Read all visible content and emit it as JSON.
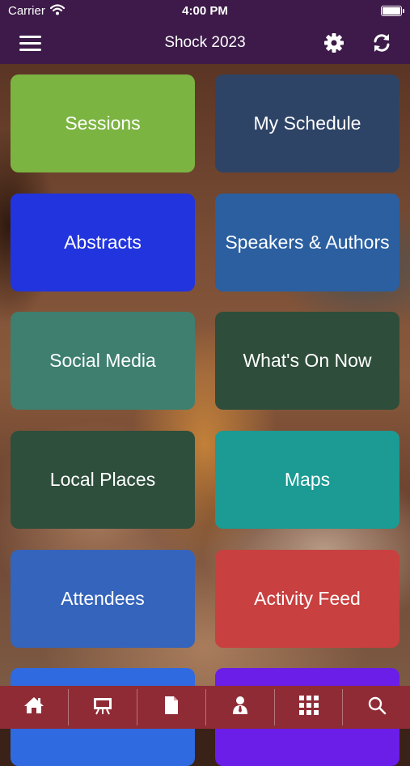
{
  "status_bar": {
    "carrier": "Carrier",
    "time": "4:00 PM"
  },
  "nav": {
    "title": "Shock 2023"
  },
  "tiles": [
    {
      "label": "Sessions",
      "color": "#7cb442"
    },
    {
      "label": "My Schedule",
      "color": "#2e4466"
    },
    {
      "label": "Abstracts",
      "color": "#2234dd"
    },
    {
      "label": "Speakers & Authors",
      "color": "#2b5fa0"
    },
    {
      "label": "Social Media",
      "color": "#3f7f6f"
    },
    {
      "label": "What's On Now",
      "color": "#2e4d3a"
    },
    {
      "label": "Local Places",
      "color": "#2e4f3c"
    },
    {
      "label": "Maps",
      "color": "#1c9a94"
    },
    {
      "label": "Attendees",
      "color": "#3464bb"
    },
    {
      "label": "Activity Feed",
      "color": "#c8403f"
    },
    {
      "label": "",
      "color": "#2f6ae0"
    },
    {
      "label": "",
      "color": "#6b1ee8"
    }
  ],
  "tab_bar": {
    "background": "#8f2b35",
    "tabs": [
      {
        "icon": "home-icon"
      },
      {
        "icon": "presentation-icon"
      },
      {
        "icon": "document-icon"
      },
      {
        "icon": "person-icon"
      },
      {
        "icon": "grid-icon"
      },
      {
        "icon": "search-icon"
      }
    ]
  }
}
